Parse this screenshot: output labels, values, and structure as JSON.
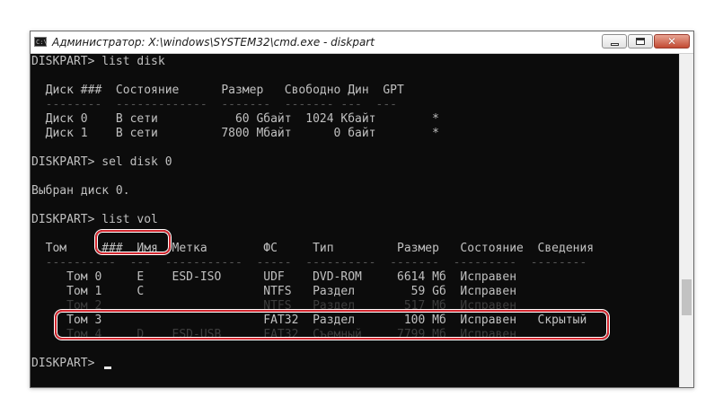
{
  "window": {
    "title": "Администратор: X:\\windows\\SYSTEM32\\cmd.exe - diskpart",
    "icon_label": "C:\\",
    "minimize_icon": "minimize-icon",
    "maximize_icon": "maximize-icon",
    "close_icon": "close-icon",
    "close_glyph": "✕"
  },
  "console": {
    "lines": [
      "DISKPART> list disk",
      "",
      "  Диск ###  Состояние      Размер   Свободно Дин  GPT",
      "  --------  -------------  -------  ------- ---  ---",
      "  Диск 0    В сети           60 Gбайт  1024 Кбайт        *",
      "  Диск 1    В сети         7800 Mбайт      0 байт        *",
      "",
      "DISKPART> sel disk 0",
      "",
      "Выбран диск 0.",
      "",
      "DISKPART> list vol",
      "",
      "  Том     ###  Имя  Метка        ФС     Тип         Размер   Состояние  Сведения",
      "  ----------  ---  -----------  -----  ----------  -------  ---------  --------",
      "     Том 0     E    ESD-ISO      UDF    DVD-ROM     6614 Мб  Исправен",
      "     Том 1     C                 NTFS   Раздел        59 Gб  Исправен",
      "     Том 2                       NTFS   Раздел       517 Мб  Исправен",
      "     Том 3                       FAT32  Раздел       100 Мб  Исправен   Скрытый",
      "     Том 4     D    ESD-USB      FAT32  Съемный     7799 Мб  Исправен",
      "",
      "DISKPART> "
    ]
  },
  "colors": {
    "console_background": "#0c0c0c",
    "console_text": "#c0c0c0",
    "highlight": "#d2272f"
  }
}
